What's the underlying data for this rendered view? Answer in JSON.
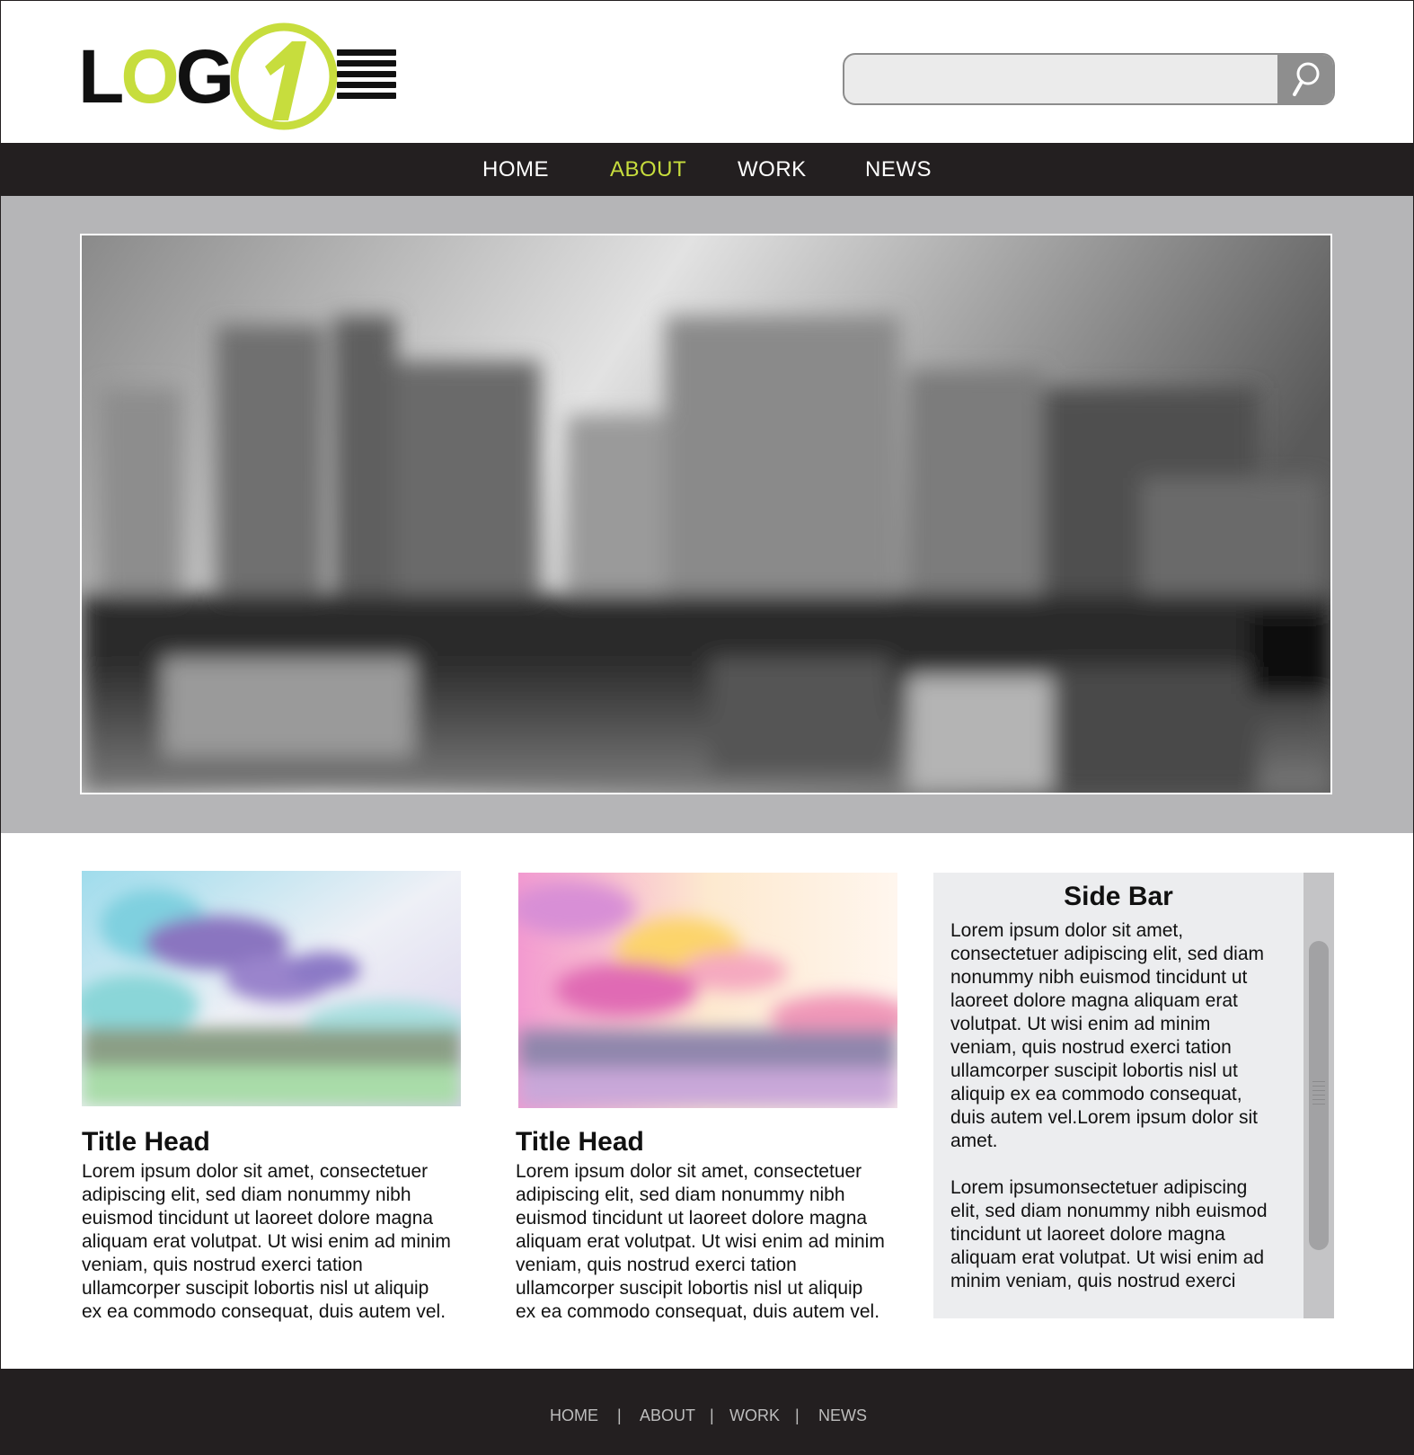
{
  "header": {
    "logo_text_prefix": "LOG",
    "logo_badge_text": "1",
    "search": {
      "placeholder": "",
      "value": "",
      "button_icon": "search-icon"
    }
  },
  "nav": {
    "items": [
      {
        "label": "HOME"
      },
      {
        "label": "ABOUT",
        "active": true
      },
      {
        "label": "WORK"
      },
      {
        "label": "NEWS"
      }
    ]
  },
  "hero": {
    "image": "blurred city skyline with water reflection (grayscale)"
  },
  "cards": [
    {
      "title": "Title Head",
      "body": "Lorem ipsum dolor sit amet, consectetuer\nadipiscing elit, sed diam nonummy nibh\neuismod tincidunt ut laoreet dolore magna\naliquam erat volutpat. Ut wisi enim ad minim\nveniam, quis nostrud exerci tation\nullamcorper suscipit lobortis nisl ut aliquip\nex ea commodo consequat, duis autem vel."
    },
    {
      "title": "Title Head",
      "body": "Lorem ipsum dolor sit amet, consectetuer\nadipiscing elit, sed diam nonummy nibh\neuismod tincidunt ut laoreet dolore magna\naliquam erat volutpat. Ut wisi enim ad minim\nveniam, quis nostrud exerci tation\nullamcorper suscipit lobortis nisl ut aliquip\nex ea commodo consequat, duis autem vel."
    }
  ],
  "sidebar": {
    "title": "Side Bar",
    "text": "Lorem ipsum dolor sit amet,\nconsectetuer adipiscing elit, sed diam\nnonummy nibh euismod tincidunt ut\nlaoreet dolore magna aliquam erat\nvolutpat. Ut wisi enim ad minim\nveniam, quis nostrud exerci tation\nullamcorper suscipit lobortis nisl ut\naliquip ex ea commodo consequat,\nduis autem vel.Lorem ipsum dolor sit\namet.\n\nLorem ipsumonsectetuer adipiscing\nelit, sed diam nonummy nibh euismod\ntincidunt ut laoreet dolore magna\naliquam erat volutpat. Ut wisi enim ad\nminim veniam, quis nostrud exerci"
  },
  "footer": {
    "items": [
      {
        "label": "HOME"
      },
      {
        "label": "ABOUT"
      },
      {
        "label": "WORK"
      },
      {
        "label": "NEWS"
      }
    ],
    "separator": "|"
  },
  "colors": {
    "accent": "#c7dd3d",
    "dark_bar": "#231f20",
    "hero_band": "#b5b5b7",
    "sidebar_bg": "#ecedef"
  }
}
